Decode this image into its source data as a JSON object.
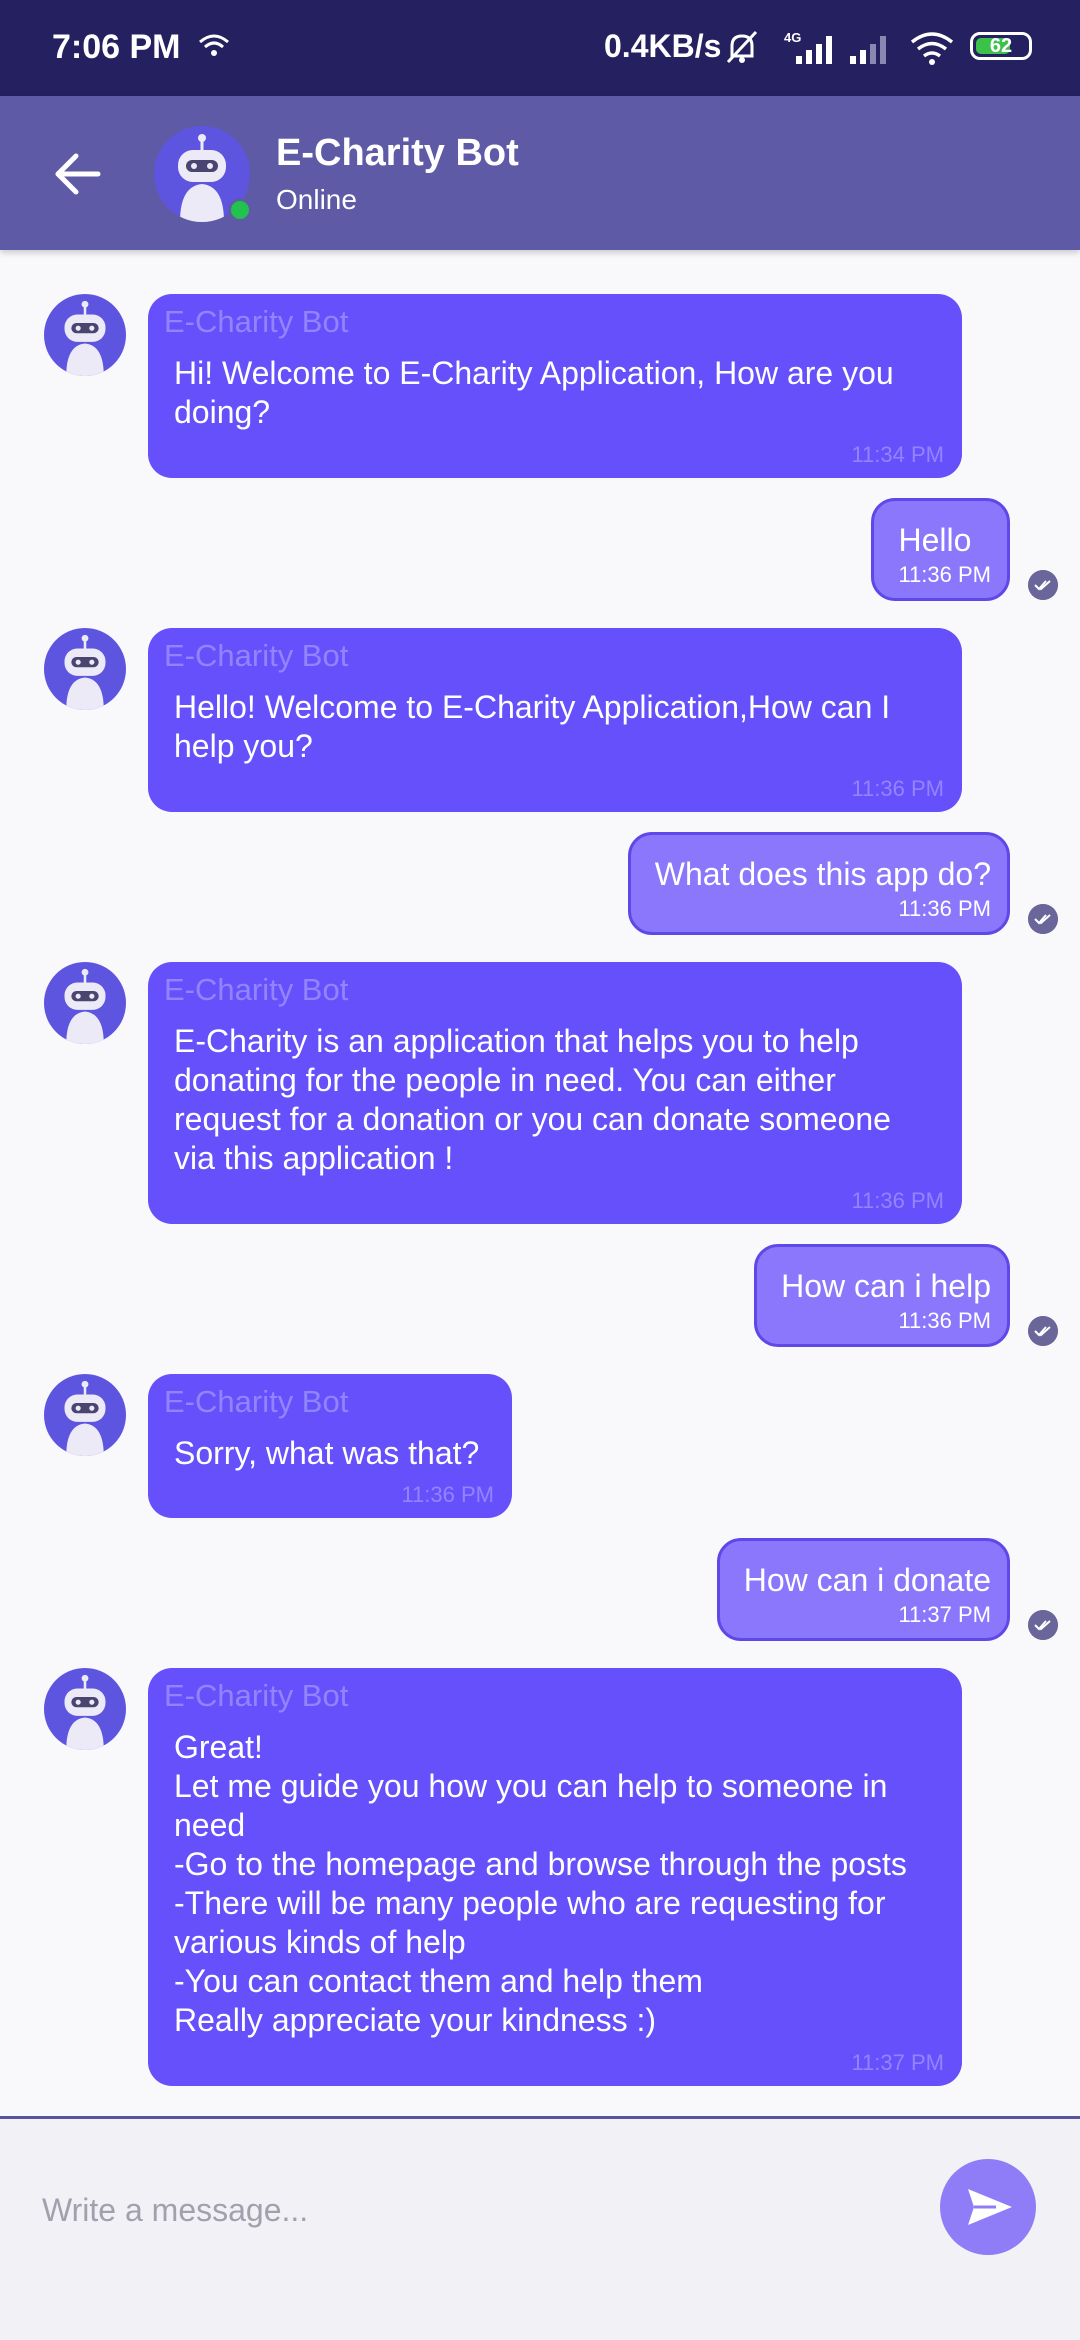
{
  "status_bar": {
    "time": "7:06 PM",
    "network_speed": "0.4KB/s",
    "network_type": "4G",
    "battery_level": "62",
    "icons": [
      "hotspot-icon",
      "mute-bell-icon",
      "signal-4g-icon",
      "signal-icon",
      "wifi-icon",
      "battery-icon"
    ]
  },
  "header": {
    "title": "E-Charity Bot",
    "status": "Online",
    "back_icon": "arrow-left-icon",
    "avatar_icon": "robot-icon"
  },
  "messages": [
    {
      "sender": "E-Charity Bot",
      "from": "bot",
      "text": "Hi! Welcome to E-Charity Application, How are you doing?",
      "time": "11:34 PM"
    },
    {
      "from": "user",
      "text": "Hello",
      "time": "11:36 PM"
    },
    {
      "sender": "E-Charity Bot",
      "from": "bot",
      "text": "Hello! Welcome to E-Charity Application,How can I help you?",
      "time": "11:36 PM"
    },
    {
      "from": "user",
      "text": "What does this app do?",
      "time": "11:36 PM"
    },
    {
      "sender": "E-Charity Bot",
      "from": "bot",
      "text": "E-Charity is an application that helps you to help donating for the people in need. You can either request for a donation or you can donate someone via this application !",
      "time": "11:36 PM"
    },
    {
      "from": "user",
      "text": "How can i help",
      "time": "11:36 PM"
    },
    {
      "sender": "E-Charity Bot",
      "from": "bot",
      "text": "Sorry, what was that?",
      "time": "11:36 PM"
    },
    {
      "from": "user",
      "text": "How can i donate",
      "time": "11:37 PM"
    },
    {
      "sender": "E-Charity Bot",
      "from": "bot",
      "text": "Great!\nLet me guide you how you can help to someone in need\n-Go to the homepage and browse through the posts\n-There will be many people who are requesting for various kinds of help\n-You can contact them and help them\nReally appreciate your kindness :)",
      "time": "11:37 PM"
    }
  ],
  "composer": {
    "placeholder": "Write a message...",
    "value": "",
    "send_icon": "send-icon"
  },
  "colors": {
    "status_bar": "#252060",
    "header": "#5f5aa6",
    "bot_bubble": "#6650fb",
    "user_bubble": "#8a77fb",
    "online": "#22c24e"
  }
}
